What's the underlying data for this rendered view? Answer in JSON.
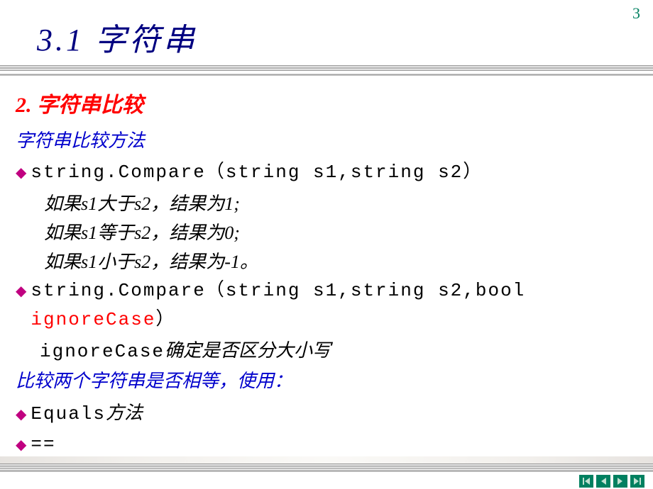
{
  "page_number": "3",
  "title": "3.1 字符串",
  "section_heading": "2. 字符串比较",
  "subtitle1": "字符串比较方法",
  "compare1": {
    "signature": "string.Compare（string s1,string s2）",
    "result_gt": "如果s1大于s2，结果为1;",
    "result_eq": "如果s1等于s2，结果为0;",
    "result_lt": "如果s1小于s2，结果为-1。"
  },
  "compare2": {
    "sig_before": "string.Compare（string s1,string s2,bool ",
    "sig_red": "ignoreCase",
    "sig_after": "）",
    "desc": "ignoreCase确定是否区分大小写"
  },
  "subtitle2": "比较两个字符串是否相等，使用：",
  "bullet_equals": "Equals方法",
  "bullet_eq_op": "==",
  "nav": {
    "first": "first",
    "prev": "prev",
    "next": "next",
    "last": "last"
  }
}
